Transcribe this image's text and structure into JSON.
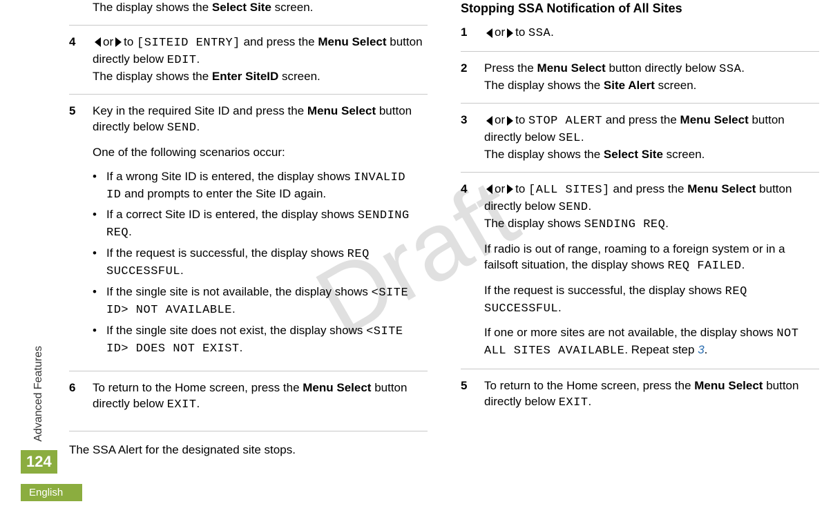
{
  "watermark": "Draft",
  "side_label": "Advanced Features",
  "page_number": "124",
  "language": "English",
  "t": {
    "or": "or",
    "to": "to",
    "and_press": " and press the ",
    "menu_select": "Menu Select",
    "btn_below": " button directly below ",
    "display_shows": "The display shows the ",
    "screen": " screen.",
    "display_shows_code": "The display shows "
  },
  "left": {
    "intro_screen": "Select Site",
    "s4": {
      "num": "4",
      "target": "[SITEID ENTRY]",
      "below": "EDIT",
      "show_screen": "Enter SiteID"
    },
    "s5": {
      "num": "5",
      "lead1a": "Key in the required Site ID and press the ",
      "lead1b": "SEND",
      "lead1c": ".",
      "lead2": "One of the following scenarios occur:",
      "items": [
        {
          "a": "If a wrong Site ID is entered, the display shows ",
          "code": "INVALID ID",
          "b": " and prompts to enter the Site ID again."
        },
        {
          "a": "If a correct Site ID is entered, the display shows ",
          "code": "SENDING REQ",
          "b": "."
        },
        {
          "a": "If the request is successful, the display shows ",
          "code": "REQ SUCCESSFUL",
          "b": "."
        },
        {
          "a": "If the single site is not available, the display shows ",
          "code": "<SITE ID> NOT AVAILABLE",
          "b": "."
        },
        {
          "a": "If the single site does not exist, the display shows ",
          "code": "<SITE ID> DOES NOT EXIST",
          "b": "."
        }
      ]
    },
    "s6": {
      "num": "6",
      "a": "To return to the Home screen, press the ",
      "below": "EXIT",
      "c": "."
    },
    "footer": "The SSA Alert for the designated site stops."
  },
  "right": {
    "heading": "Stopping SSA Notification of All Sites",
    "s1": {
      "num": "1",
      "target": "SSA",
      "tail": "."
    },
    "s2": {
      "num": "2",
      "a": "Press the ",
      "below": "SSA",
      "c": ".",
      "screen": "Site Alert"
    },
    "s3": {
      "num": "3",
      "target": "STOP ALERT",
      "below": "SEL",
      "c": ".",
      "screen": "Select Site"
    },
    "s4": {
      "num": "4",
      "target": "[ALL SITES]",
      "below": "SEND",
      "c": ".",
      "show_code": "SENDING REQ",
      "p2a": "If radio is out of range, roaming to a foreign system or in a failsoft situation, the display shows ",
      "p2code": "REQ FAILED",
      "p2b": ".",
      "p3a": "If the request is successful, the display shows ",
      "p3code": "REQ SUCCESSFUL",
      "p3b": ".",
      "p4a": "If one or more sites are not available, the display shows ",
      "p4code": "NOT ALL SITES AVAILABLE",
      "p4b": ". Repeat step ",
      "p4link": "3",
      "p4c": "."
    },
    "s5": {
      "num": "5",
      "a": "To return to the Home screen, press the ",
      "below": "EXIT",
      "c": "."
    }
  }
}
